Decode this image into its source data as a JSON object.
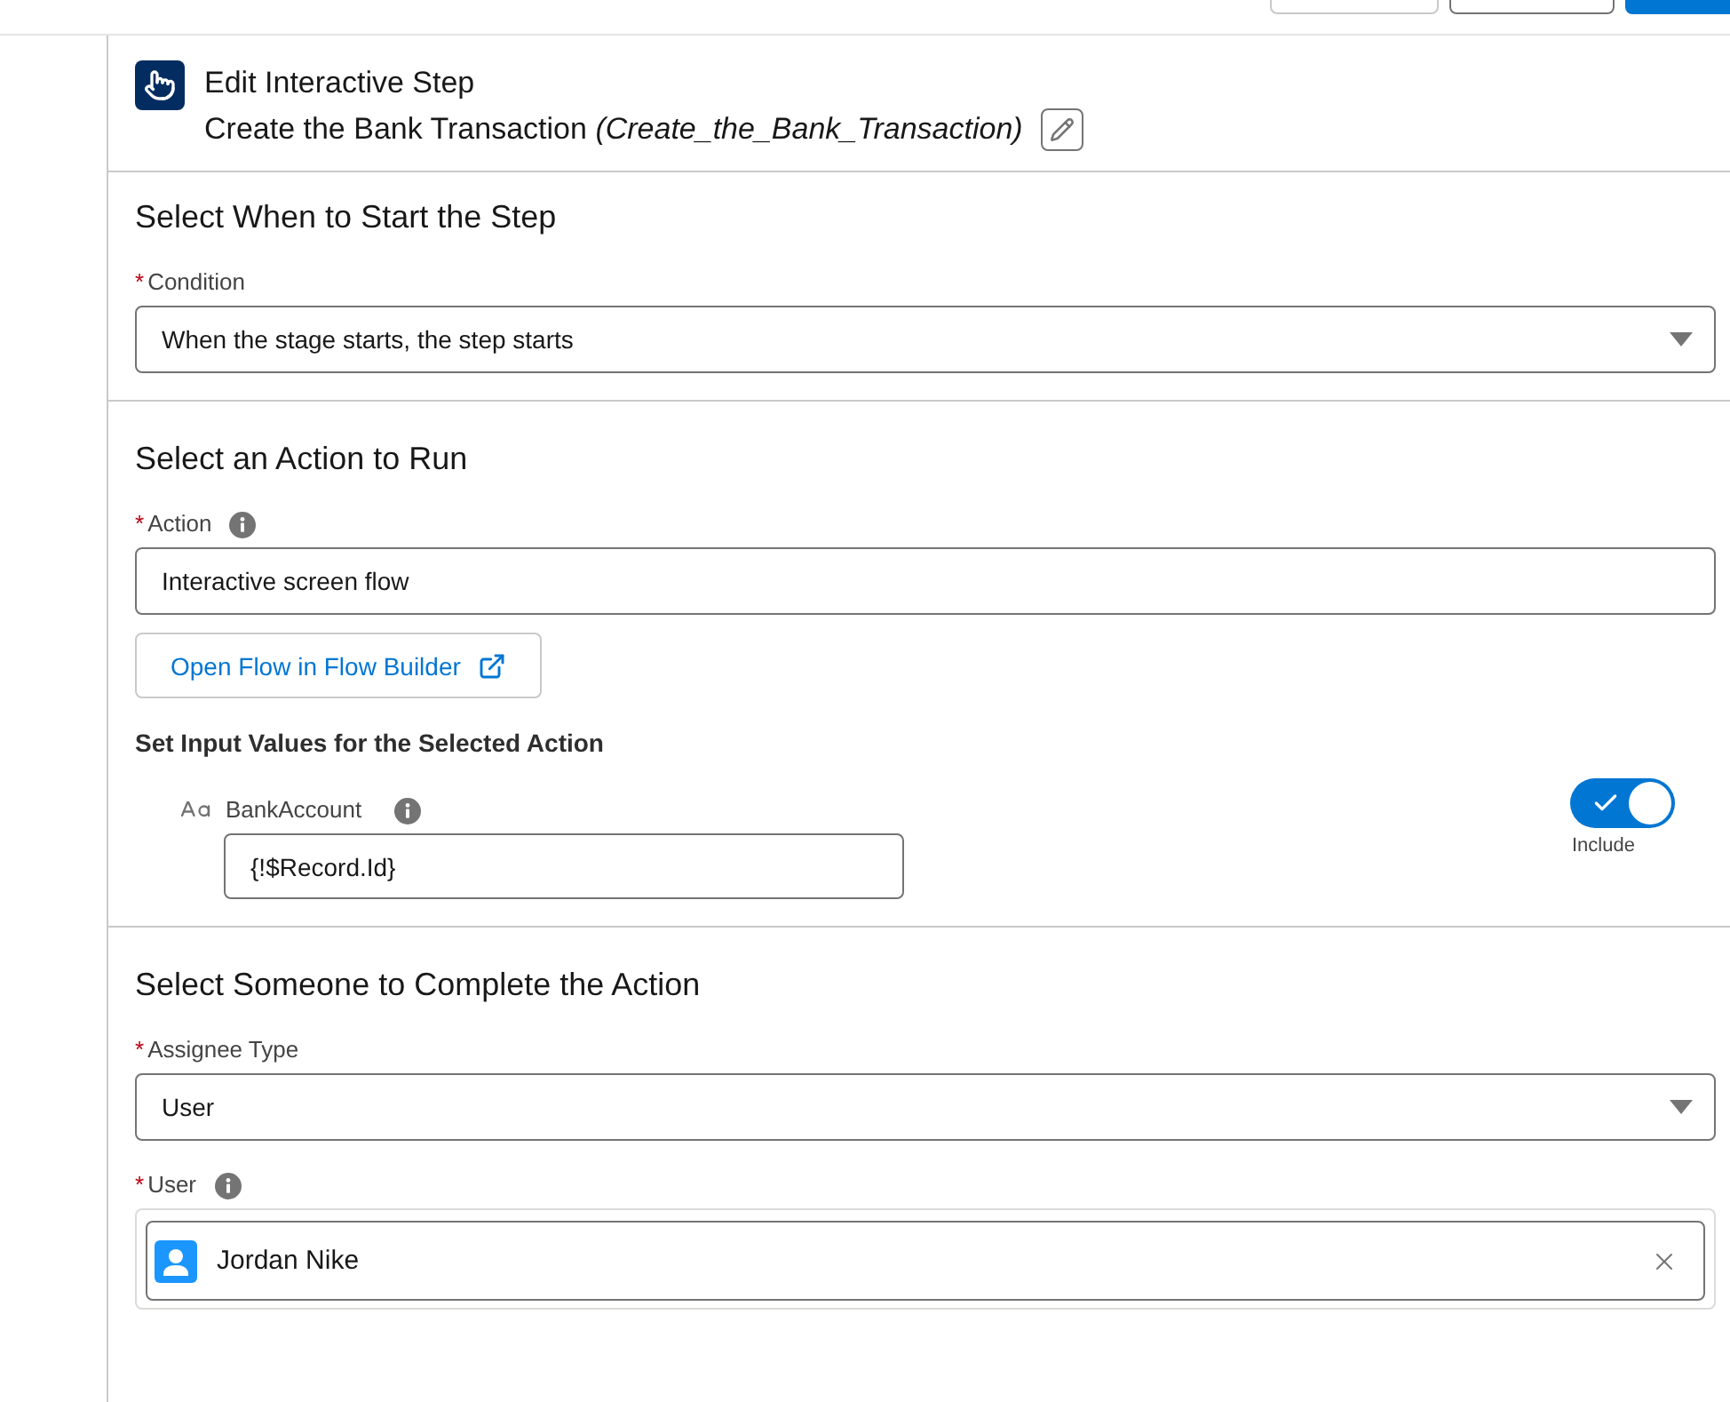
{
  "toolbar_buttons": [
    {
      "kind": "plain"
    },
    {
      "kind": "neutral"
    },
    {
      "kind": "brand"
    }
  ],
  "header": {
    "title": "Edit Interactive Step",
    "subtitle": "Create the Bank Transaction *(Create_the_Bank_Transaction)*"
  },
  "sections": [
    {
      "title": "Select When to Start the Step",
      "fields": [
        {
          "kind": "combobox",
          "label": "Condition",
          "required_mark": "*",
          "info": false,
          "value": "When the stage starts, the step starts"
        }
      ]
    },
    {
      "title": "Select an Action to Run",
      "fields": [
        {
          "kind": "input",
          "label": "Action",
          "required_mark": "*",
          "info": true,
          "value": "Interactive screen flow"
        },
        {
          "kind": "link_button",
          "label": "Open Flow in Flow Builder"
        },
        {
          "kind": "subheading",
          "label": "Set Input Values for the Selected Action"
        },
        {
          "kind": "parameter",
          "label": "BankAccount",
          "info": true,
          "value": "{!$Record.Id}",
          "toggle": {
            "label": "Include",
            "on": true
          }
        }
      ]
    },
    {
      "title": "Select Someone to Complete the Action",
      "fields": [
        {
          "kind": "combobox",
          "label": "Assignee Type",
          "required_mark": "*",
          "info": false,
          "value": "User"
        },
        {
          "kind": "lookup",
          "label": "User",
          "required_mark": "*",
          "info": true,
          "value": "Jordan Nike"
        }
      ]
    }
  ]
}
